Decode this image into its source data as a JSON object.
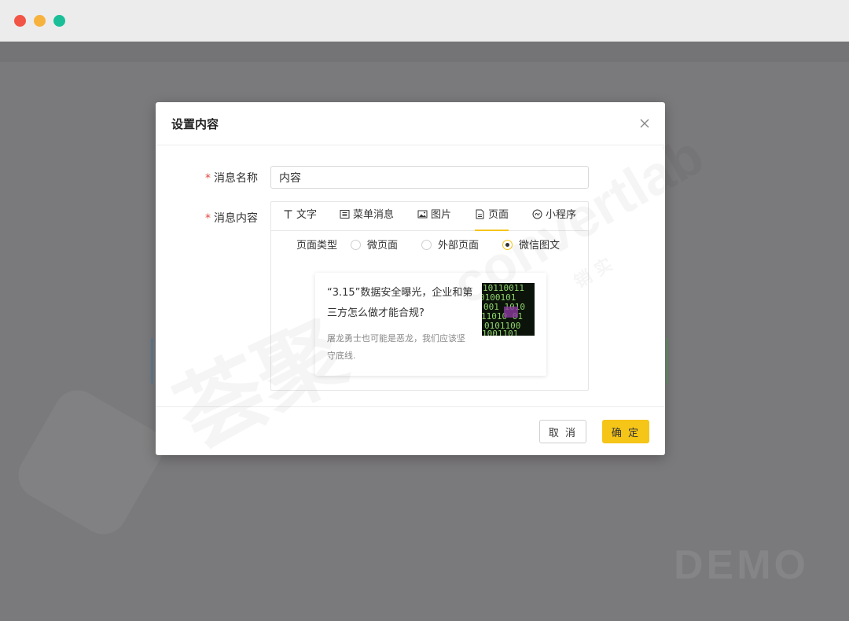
{
  "backdrop": {
    "demo_text": "DEMO"
  },
  "modal": {
    "title": "设置内容",
    "name_field": {
      "required_mark": "*",
      "label": "消息名称",
      "value": "内容"
    },
    "content_field": {
      "required_mark": "*",
      "label": "消息内容"
    },
    "tabs": [
      {
        "label": "文字",
        "icon": "text-icon"
      },
      {
        "label": "菜单消息",
        "icon": "menu-list-icon"
      },
      {
        "label": "图片",
        "icon": "image-icon"
      },
      {
        "label": "页面",
        "icon": "page-icon",
        "active": true
      },
      {
        "label": "小程序",
        "icon": "mini-program-icon"
      }
    ],
    "page_type": {
      "label": "页面类型",
      "options": [
        "微页面",
        "外部页面",
        "微信图文"
      ],
      "selected": "微信图文"
    },
    "article": {
      "title": "“3.15”数据安全曝光，企业和第三方怎么做才能合规?",
      "description": "屠龙勇士也可能是恶龙，我们应该坚守底线."
    },
    "buttons": {
      "cancel": "取 消",
      "ok": "确 定"
    }
  },
  "watermark": {
    "brand_text": "荟聚",
    "brand_latin": "convertlab",
    "sub_text": "销 实"
  },
  "colors": {
    "accent": "#f5c518",
    "required": "#e2463d",
    "backdrop": "#7a797b",
    "traffic_red": "#f25545",
    "traffic_yellow": "#f6b23d",
    "traffic_green": "#1bbf97"
  }
}
